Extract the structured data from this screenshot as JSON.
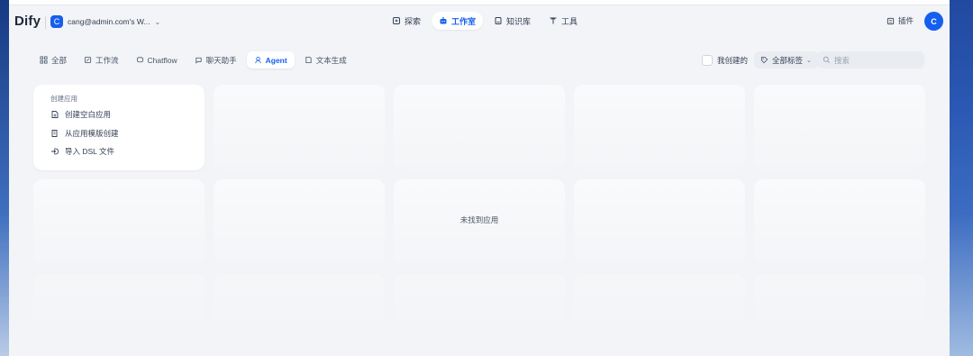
{
  "app": {
    "logo_text": "Dify"
  },
  "workspace": {
    "avatar_letter": "C",
    "name": "cang@admin.com's W..."
  },
  "nav": [
    {
      "label": "探索",
      "icon": "explore-icon"
    },
    {
      "label": "工作室",
      "icon": "robot-icon"
    },
    {
      "label": "知识库",
      "icon": "book-icon"
    },
    {
      "label": "工具",
      "icon": "tool-icon"
    }
  ],
  "nav_active": "工作室",
  "header_right": {
    "plugin_label": "插件",
    "user_avatar_letter": "C"
  },
  "tabs": [
    {
      "label": "全部",
      "icon": "grid-icon"
    },
    {
      "label": "工作流",
      "icon": "workflow-icon"
    },
    {
      "label": "Chatflow",
      "icon": "chatflow-icon"
    },
    {
      "label": "聊天助手",
      "icon": "chat-icon"
    },
    {
      "label": "Agent",
      "icon": "agent-icon"
    },
    {
      "label": "文本生成",
      "icon": "doc-icon"
    }
  ],
  "tab_active": "Agent",
  "filters": {
    "mine_label": "我创建的",
    "mine_checked": false,
    "tags_label": "全部标签",
    "search_placeholder": "搜索"
  },
  "create_card": {
    "title": "创建应用",
    "items": [
      {
        "label": "创建空白应用",
        "icon": "file-plus-icon"
      },
      {
        "label": "从应用模版创建",
        "icon": "template-icon"
      },
      {
        "label": "导入 DSL 文件",
        "icon": "import-icon"
      }
    ]
  },
  "empty_message": "未找到应用",
  "colors": {
    "accent": "#155eef",
    "page_bg": "#f2f4f7"
  }
}
